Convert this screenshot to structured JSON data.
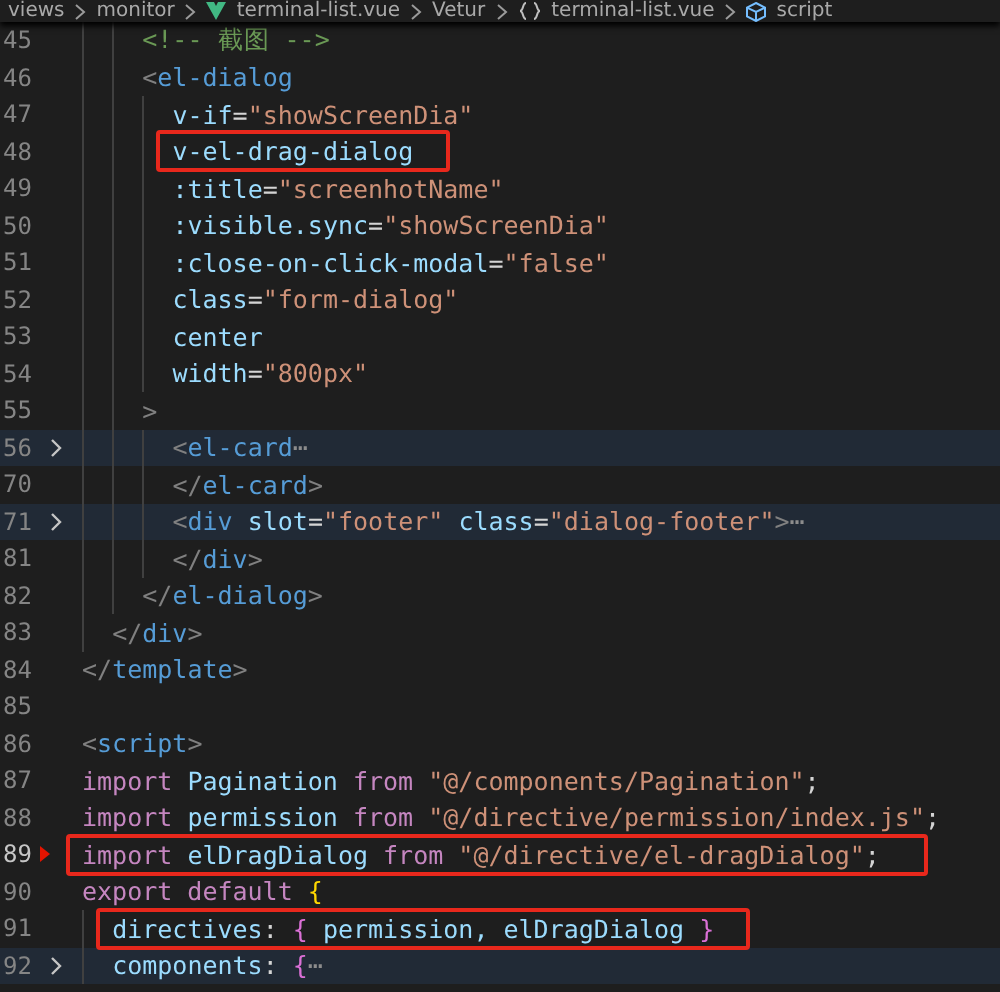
{
  "breadcrumb": [
    {
      "kind": "folder",
      "text": "views"
    },
    {
      "kind": "folder",
      "text": "monitor"
    },
    {
      "kind": "vue",
      "text": "terminal-list.vue"
    },
    {
      "kind": "plain",
      "text": "Vetur"
    },
    {
      "kind": "braces",
      "text": "terminal-list.vue"
    },
    {
      "kind": "cube",
      "text": "script"
    }
  ],
  "lines": [
    {
      "number": "45",
      "tokens": [
        {
          "kind": "comment",
          "text": "    <!-- 截图 -->"
        }
      ]
    },
    {
      "number": "46",
      "tokens": [
        {
          "kind": "punct",
          "text": "    <"
        },
        {
          "kind": "tag",
          "text": "el-dialog"
        }
      ]
    },
    {
      "number": "47",
      "tokens": [
        {
          "kind": "attr",
          "text": "      v-if"
        },
        {
          "kind": "plain",
          "text": "="
        },
        {
          "kind": "string",
          "text": "\"showScreenDia\""
        }
      ]
    },
    {
      "number": "48",
      "highlighted": true,
      "tokens": [
        {
          "kind": "attr",
          "text": "      v-el-drag-dialog"
        }
      ]
    },
    {
      "number": "49",
      "tokens": [
        {
          "kind": "attr",
          "text": "      :title"
        },
        {
          "kind": "plain",
          "text": "="
        },
        {
          "kind": "string",
          "text": "\"screenhotName\""
        }
      ]
    },
    {
      "number": "50",
      "tokens": [
        {
          "kind": "attr",
          "text": "      :visible.sync"
        },
        {
          "kind": "plain",
          "text": "="
        },
        {
          "kind": "string",
          "text": "\"showScreenDia\""
        }
      ]
    },
    {
      "number": "51",
      "tokens": [
        {
          "kind": "attr",
          "text": "      :close-on-click-modal"
        },
        {
          "kind": "plain",
          "text": "="
        },
        {
          "kind": "string",
          "text": "\"false\""
        }
      ]
    },
    {
      "number": "52",
      "tokens": [
        {
          "kind": "attr",
          "text": "      class"
        },
        {
          "kind": "plain",
          "text": "="
        },
        {
          "kind": "string",
          "text": "\"form-dialog\""
        }
      ]
    },
    {
      "number": "53",
      "tokens": [
        {
          "kind": "attr",
          "text": "      center"
        }
      ]
    },
    {
      "number": "54",
      "tokens": [
        {
          "kind": "attr",
          "text": "      width"
        },
        {
          "kind": "plain",
          "text": "="
        },
        {
          "kind": "string",
          "text": "\"800px\""
        }
      ]
    },
    {
      "number": "55",
      "tokens": [
        {
          "kind": "punct",
          "text": "    >"
        }
      ]
    },
    {
      "number": "56",
      "folded": true,
      "tokens": [
        {
          "kind": "punct",
          "text": "      <"
        },
        {
          "kind": "tag",
          "text": "el-card"
        },
        {
          "kind": "fold",
          "text": "⋯"
        }
      ]
    },
    {
      "number": "70",
      "tokens": [
        {
          "kind": "punct",
          "text": "      </"
        },
        {
          "kind": "tag",
          "text": "el-card"
        },
        {
          "kind": "punct",
          "text": ">"
        }
      ]
    },
    {
      "number": "71",
      "folded": true,
      "tokens": [
        {
          "kind": "punct",
          "text": "      <"
        },
        {
          "kind": "tag",
          "text": "div "
        },
        {
          "kind": "attr",
          "text": "slot"
        },
        {
          "kind": "plain",
          "text": "="
        },
        {
          "kind": "string",
          "text": "\"footer\" "
        },
        {
          "kind": "attr",
          "text": "class"
        },
        {
          "kind": "plain",
          "text": "="
        },
        {
          "kind": "string",
          "text": "\"dialog-footer\""
        },
        {
          "kind": "punct",
          "text": ">"
        },
        {
          "kind": "fold",
          "text": "⋯"
        }
      ]
    },
    {
      "number": "81",
      "tokens": [
        {
          "kind": "punct",
          "text": "      </"
        },
        {
          "kind": "tag",
          "text": "div"
        },
        {
          "kind": "punct",
          "text": ">"
        }
      ]
    },
    {
      "number": "82",
      "tokens": [
        {
          "kind": "punct",
          "text": "    </"
        },
        {
          "kind": "tag",
          "text": "el-dialog"
        },
        {
          "kind": "punct",
          "text": ">"
        }
      ]
    },
    {
      "number": "83",
      "tokens": [
        {
          "kind": "punct",
          "text": "  </"
        },
        {
          "kind": "tag",
          "text": "div"
        },
        {
          "kind": "punct",
          "text": ">"
        }
      ]
    },
    {
      "number": "84",
      "tokens": [
        {
          "kind": "punct",
          "text": "</"
        },
        {
          "kind": "tag",
          "text": "template"
        },
        {
          "kind": "punct",
          "text": ">"
        }
      ]
    },
    {
      "number": "85"
    },
    {
      "number": "86",
      "tokens": [
        {
          "kind": "punct",
          "text": "<"
        },
        {
          "kind": "tag",
          "text": "script"
        },
        {
          "kind": "punct",
          "text": ">"
        }
      ]
    },
    {
      "number": "87",
      "tokens": [
        {
          "kind": "keyword",
          "text": "import "
        },
        {
          "kind": "ident",
          "text": "Pagination "
        },
        {
          "kind": "keyword",
          "text": "from "
        },
        {
          "kind": "string",
          "text": "\"@/components/Pagination\""
        },
        {
          "kind": "plain",
          "text": ";"
        }
      ]
    },
    {
      "number": "88",
      "tokens": [
        {
          "kind": "keyword",
          "text": "import "
        },
        {
          "kind": "ident",
          "text": "permission "
        },
        {
          "kind": "keyword",
          "text": "from "
        },
        {
          "kind": "string",
          "text": "\"@/directive/permission/index.js\""
        },
        {
          "kind": "plain",
          "text": ";"
        }
      ]
    },
    {
      "number": "89",
      "current": true,
      "deleted_marker": true,
      "highlighted": true,
      "tokens": [
        {
          "kind": "keyword",
          "text": "import "
        },
        {
          "kind": "ident",
          "text": "elDragDialog "
        },
        {
          "kind": "keyword",
          "text": "from "
        },
        {
          "kind": "string",
          "text": "\"@/directive/el-dragDialog\""
        },
        {
          "kind": "plain",
          "text": ";"
        }
      ]
    },
    {
      "number": "90",
      "tokens": [
        {
          "kind": "keyword",
          "text": "export default "
        },
        {
          "kind": "brace",
          "text": "{"
        }
      ]
    },
    {
      "number": "91",
      "highlighted": true,
      "tokens": [
        {
          "kind": "ident",
          "text": "  directives"
        },
        {
          "kind": "plain",
          "text": ": "
        },
        {
          "kind": "brace2",
          "text": "{ "
        },
        {
          "kind": "ident",
          "text": "permission, elDragDialog "
        },
        {
          "kind": "brace2",
          "text": "}"
        }
      ]
    },
    {
      "number": "92",
      "folded": true,
      "tokens": [
        {
          "kind": "ident",
          "text": "  components"
        },
        {
          "kind": "plain",
          "text": ": "
        },
        {
          "kind": "brace2",
          "text": "{"
        },
        {
          "kind": "fold",
          "text": "⋯"
        }
      ]
    }
  ]
}
